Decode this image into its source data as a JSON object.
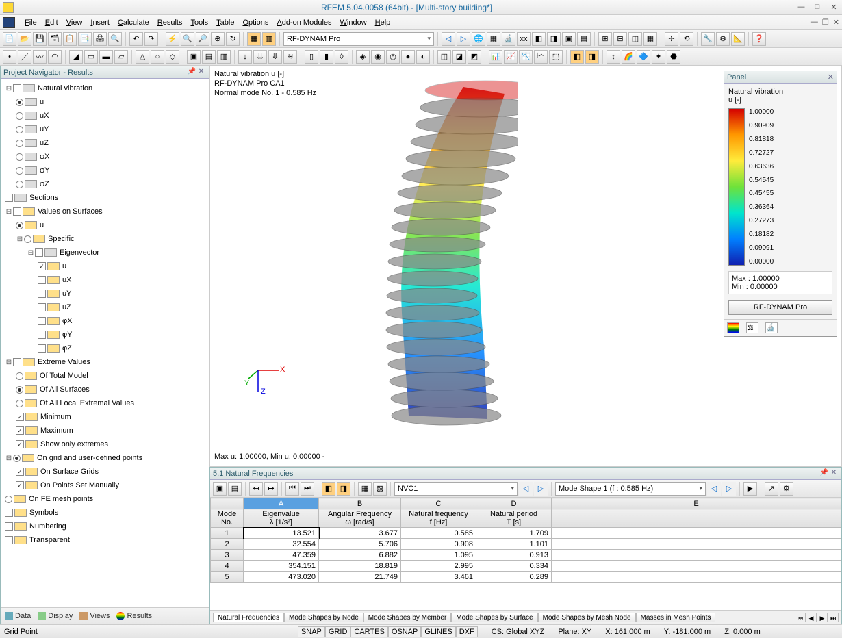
{
  "titlebar": {
    "title": "RFEM 5.04.0058 (64bit) - [Multi-story building*]"
  },
  "menu": [
    "File",
    "Edit",
    "View",
    "Insert",
    "Calculate",
    "Results",
    "Tools",
    "Table",
    "Options",
    "Add-on Modules",
    "Window",
    "Help"
  ],
  "toolbar1_dropdown": "RF-DYNAM Pro",
  "navigator": {
    "title": "Project Navigator - Results",
    "tabs": [
      "Data",
      "Display",
      "Views",
      "Results"
    ]
  },
  "tree": {
    "root1": "Natural vibration",
    "root1_children": [
      "u",
      "uX",
      "uY",
      "uZ",
      "φX",
      "φY",
      "φZ"
    ],
    "sections": "Sections",
    "vos": "Values on Surfaces",
    "vos_u": "u",
    "specific": "Specific",
    "eigen": "Eigenvector",
    "eigen_children": [
      "u",
      "uX",
      "uY",
      "uZ",
      "φX",
      "φY",
      "φZ"
    ],
    "extreme": "Extreme Values",
    "extreme_children": [
      "Of Total Model",
      "Of All Surfaces",
      "Of All Local Extremal Values",
      "Minimum",
      "Maximum",
      "Show only extremes"
    ],
    "ongrid": "On grid and user-defined points",
    "ongrid_children": [
      "On Surface Grids",
      "On Points Set Manually"
    ],
    "fe": "On FE mesh points",
    "symbols": "Symbols",
    "numbering": "Numbering",
    "transparent": "Transparent"
  },
  "viewport": {
    "line1": "Natural vibration u [-]",
    "line2": "RF-DYNAM Pro CA1",
    "line3": "Normal mode No. 1 - 0.585 Hz",
    "bottom": "Max u: 1.00000, Min u: 0.00000 -"
  },
  "legend": {
    "title": "Panel",
    "sub1": "Natural vibration",
    "sub2": "u [-]",
    "scale": [
      "1.00000",
      "0.90909",
      "0.81818",
      "0.72727",
      "0.63636",
      "0.54545",
      "0.45455",
      "0.36364",
      "0.27273",
      "0.18182",
      "0.09091",
      "0.00000"
    ],
    "max": "Max  :  1.00000",
    "min": "Min   :  0.00000",
    "button": "RF-DYNAM Pro"
  },
  "freq_panel": {
    "title": "5.1 Natural Frequencies",
    "dropdown1": "NVC1",
    "dropdown2": "Mode Shape 1 (f : 0.585 Hz)",
    "col_letters": [
      "A",
      "B",
      "C",
      "D",
      "E"
    ],
    "headers": [
      {
        "top": "Mode",
        "bot": "No."
      },
      {
        "top": "Eigenvalue",
        "bot": "λ [1/s²]"
      },
      {
        "top": "Angular Frequency",
        "bot": "ω [rad/s]"
      },
      {
        "top": "Natural frequency",
        "bot": "f [Hz]"
      },
      {
        "top": "Natural period",
        "bot": "T [s]"
      }
    ],
    "rows": [
      {
        "mode": "1",
        "eigen": "13.521",
        "ang": "3.677",
        "freq": "0.585",
        "period": "1.709"
      },
      {
        "mode": "2",
        "eigen": "32.554",
        "ang": "5.706",
        "freq": "0.908",
        "period": "1.101"
      },
      {
        "mode": "3",
        "eigen": "47.359",
        "ang": "6.882",
        "freq": "1.095",
        "period": "0.913"
      },
      {
        "mode": "4",
        "eigen": "354.151",
        "ang": "18.819",
        "freq": "2.995",
        "period": "0.334"
      },
      {
        "mode": "5",
        "eigen": "473.020",
        "ang": "21.749",
        "freq": "3.461",
        "period": "0.289"
      }
    ],
    "tabs": [
      "Natural Frequencies",
      "Mode Shapes by Node",
      "Mode Shapes by Member",
      "Mode Shapes by Surface",
      "Mode Shapes by Mesh Node",
      "Masses in Mesh Points"
    ]
  },
  "status": {
    "left": "Grid Point",
    "toggles": [
      "SNAP",
      "GRID",
      "CARTES",
      "OSNAP",
      "GLINES",
      "DXF"
    ],
    "cs": "CS: Global XYZ",
    "plane": "Plane: XY",
    "x": "X:  161.000 m",
    "y": "Y:  -181.000 m",
    "z": "Z:  0.000 m"
  },
  "chart_data": {
    "type": "table",
    "title": "5.1 Natural Frequencies",
    "columns": [
      "Mode No.",
      "Eigenvalue λ [1/s²]",
      "Angular Frequency ω [rad/s]",
      "Natural frequency f [Hz]",
      "Natural period T [s]"
    ],
    "rows": [
      [
        1,
        13.521,
        3.677,
        0.585,
        1.709
      ],
      [
        2,
        32.554,
        5.706,
        0.908,
        1.101
      ],
      [
        3,
        47.359,
        6.882,
        1.095,
        0.913
      ],
      [
        4,
        354.151,
        18.819,
        2.995,
        0.334
      ],
      [
        5,
        473.02,
        21.749,
        3.461,
        0.289
      ]
    ],
    "color_scale": {
      "min": 0.0,
      "max": 1.0,
      "unit": "u [-]",
      "steps": 12
    }
  }
}
